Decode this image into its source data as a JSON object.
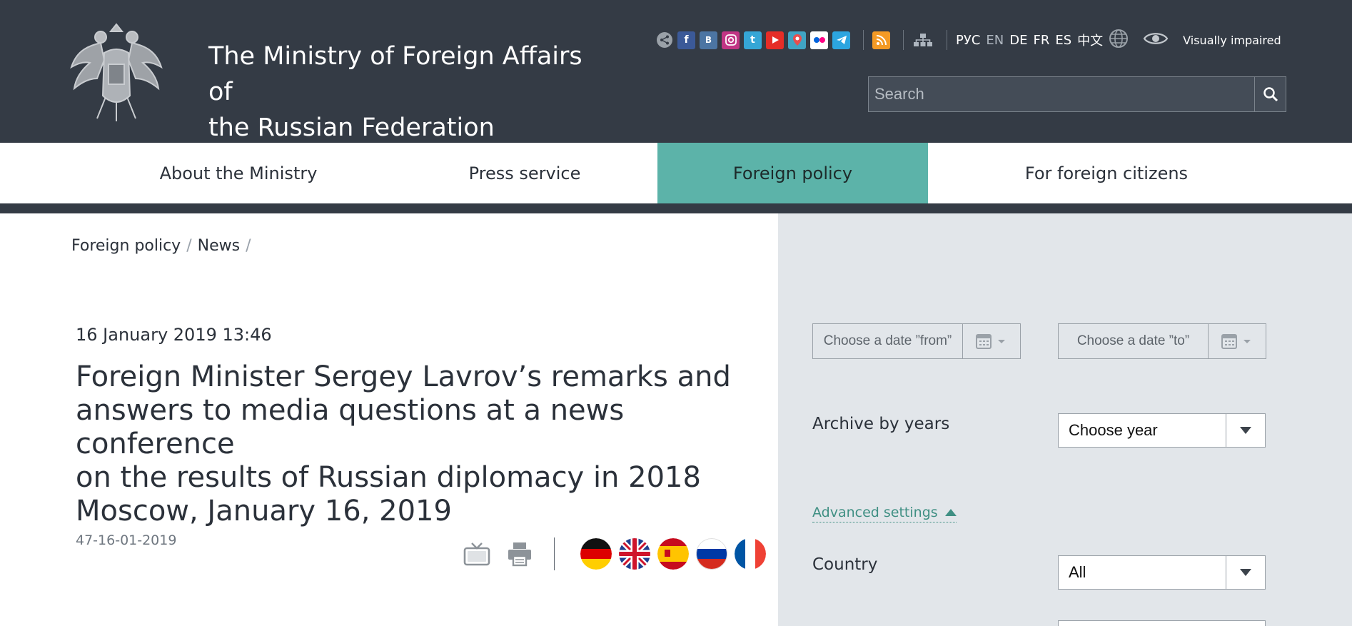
{
  "header": {
    "title_line1": "The Ministry of Foreign Affairs of",
    "title_line2": "the Russian Federation",
    "social_icons": [
      "share-icon",
      "facebook-icon",
      "vkontakte-icon",
      "instagram-icon",
      "tumblr-icon",
      "youtube-icon",
      "periscope-icon",
      "flickr-icon",
      "telegram-icon"
    ],
    "facebook_glyph": "f",
    "vk_glyph": "B",
    "tumblr_glyph": "t",
    "languages": [
      "РУС",
      "EN",
      "DE",
      "FR",
      "ES",
      "中文"
    ],
    "visually_impaired_label": "Visually impaired",
    "search_placeholder": "Search",
    "colors": {
      "background": "#343b45",
      "accent": "#5cb3a9"
    }
  },
  "nav": {
    "items": [
      {
        "label": "About the Ministry",
        "active": false
      },
      {
        "label": "Press service",
        "active": false
      },
      {
        "label": "Foreign policy",
        "active": true
      },
      {
        "label": "For foreign citizens",
        "active": false
      }
    ]
  },
  "breadcrumb": [
    "Foreign policy",
    "News"
  ],
  "article": {
    "date": "16 January 2019 13:46",
    "title_line1": "Foreign Minister Sergey Lavrov’s remarks and",
    "title_line2": "answers to media questions at a news conference",
    "title_line3": "on the results of Russian diplomacy in 2018",
    "title_line4": "Moscow, January 16, 2019",
    "doc_number": "47-16-01-2019",
    "language_flags": [
      "german-flag",
      "english-flag",
      "spanish-flag",
      "russian-flag",
      "french-flag"
    ]
  },
  "sidebar": {
    "date_from_placeholder": "Choose a date ”from”",
    "date_to_placeholder": "Choose a date ”to”",
    "archive_label": "Archive by years",
    "year_select_value": "Choose year",
    "advanced_settings_label": "Advanced settings",
    "country_label": "Country",
    "country_select_value": "All"
  }
}
